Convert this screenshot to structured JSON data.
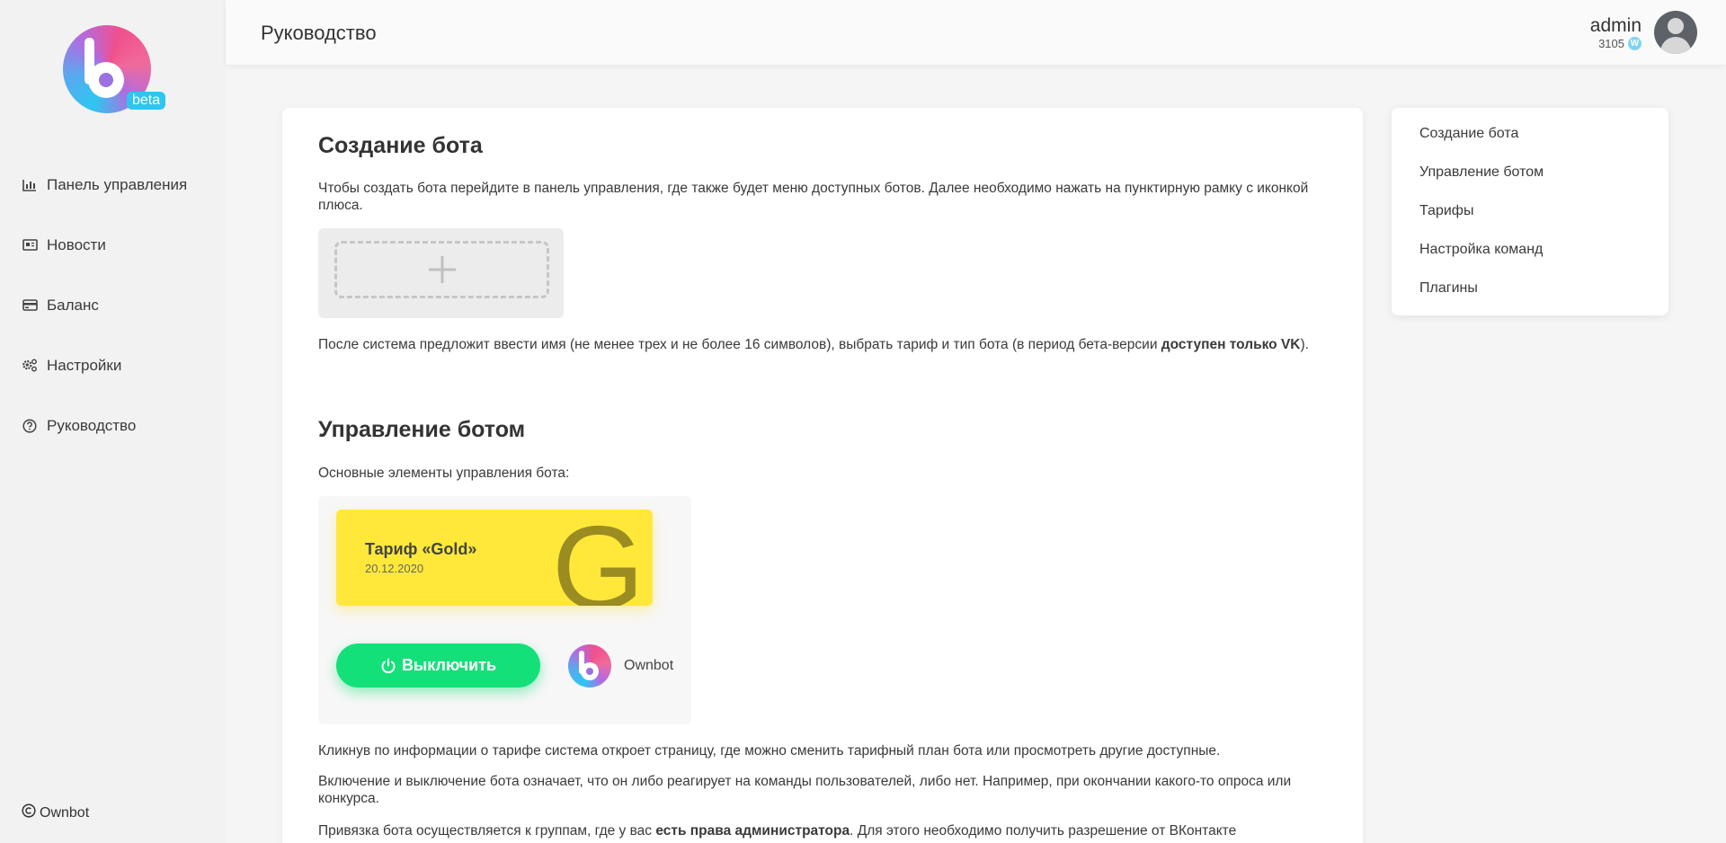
{
  "sidebar": {
    "logo_badge": "beta",
    "items": [
      {
        "label": "Панель управления",
        "icon": "bar-chart-icon"
      },
      {
        "label": "Новости",
        "icon": "newspaper-icon"
      },
      {
        "label": "Баланс",
        "icon": "credit-card-icon"
      },
      {
        "label": "Настройки",
        "icon": "gears-icon"
      },
      {
        "label": "Руководство",
        "icon": "question-circle-icon"
      }
    ],
    "footer": "Ownbot"
  },
  "topbar": {
    "title": "Руководство",
    "user_name": "admin",
    "balance": "3105",
    "coin_symbol": "W"
  },
  "main": {
    "section1": {
      "title": "Создание бота",
      "p1": "Чтобы создать бота перейдите в панель управления, где также будет меню доступных ботов. Далее необходимо нажать на пунктирную рамку с иконкой плюса.",
      "p2_start": "После система предложит ввести имя (не менее трех и не более 16 символов), выбрать тариф и тип бота (в период бета-версии ",
      "p2_bold": "доступен только VK",
      "p2_end": ")."
    },
    "section2": {
      "title": "Управление ботом",
      "p1": "Основные элементы управления бота:",
      "tariff_name": "Тариф «Gold»",
      "tariff_date": "20.12.2020",
      "tariff_letter": "G",
      "toggle_label": "Выключить",
      "bot_name": "Ownbot",
      "p2": "Кликнув по информации о тарифе система откроет страницу, где можно сменить тарифный план бота или просмотреть другие доступные.",
      "p3": "Включение и выключение бота означает, что он либо реагирует на команды пользователей, либо нет. Например, при окончании какого-то опроса или конкурса.",
      "p4_start": "Привязка бота осуществляется к группам, где у вас ",
      "p4_bold": "есть права администратора",
      "p4_end": ". Для этого необходимо получить разрешение от ВКонтакте"
    }
  },
  "toc": {
    "items": [
      "Создание бота",
      "Управление ботом",
      "Тарифы",
      "Настройка команд",
      "Плагины"
    ]
  },
  "colors": {
    "accent_green": "#14e07a",
    "tariff_yellow": "#ffe83a",
    "logo_cyan": "#2ec6f0",
    "logo_pink": "#f0508c"
  }
}
